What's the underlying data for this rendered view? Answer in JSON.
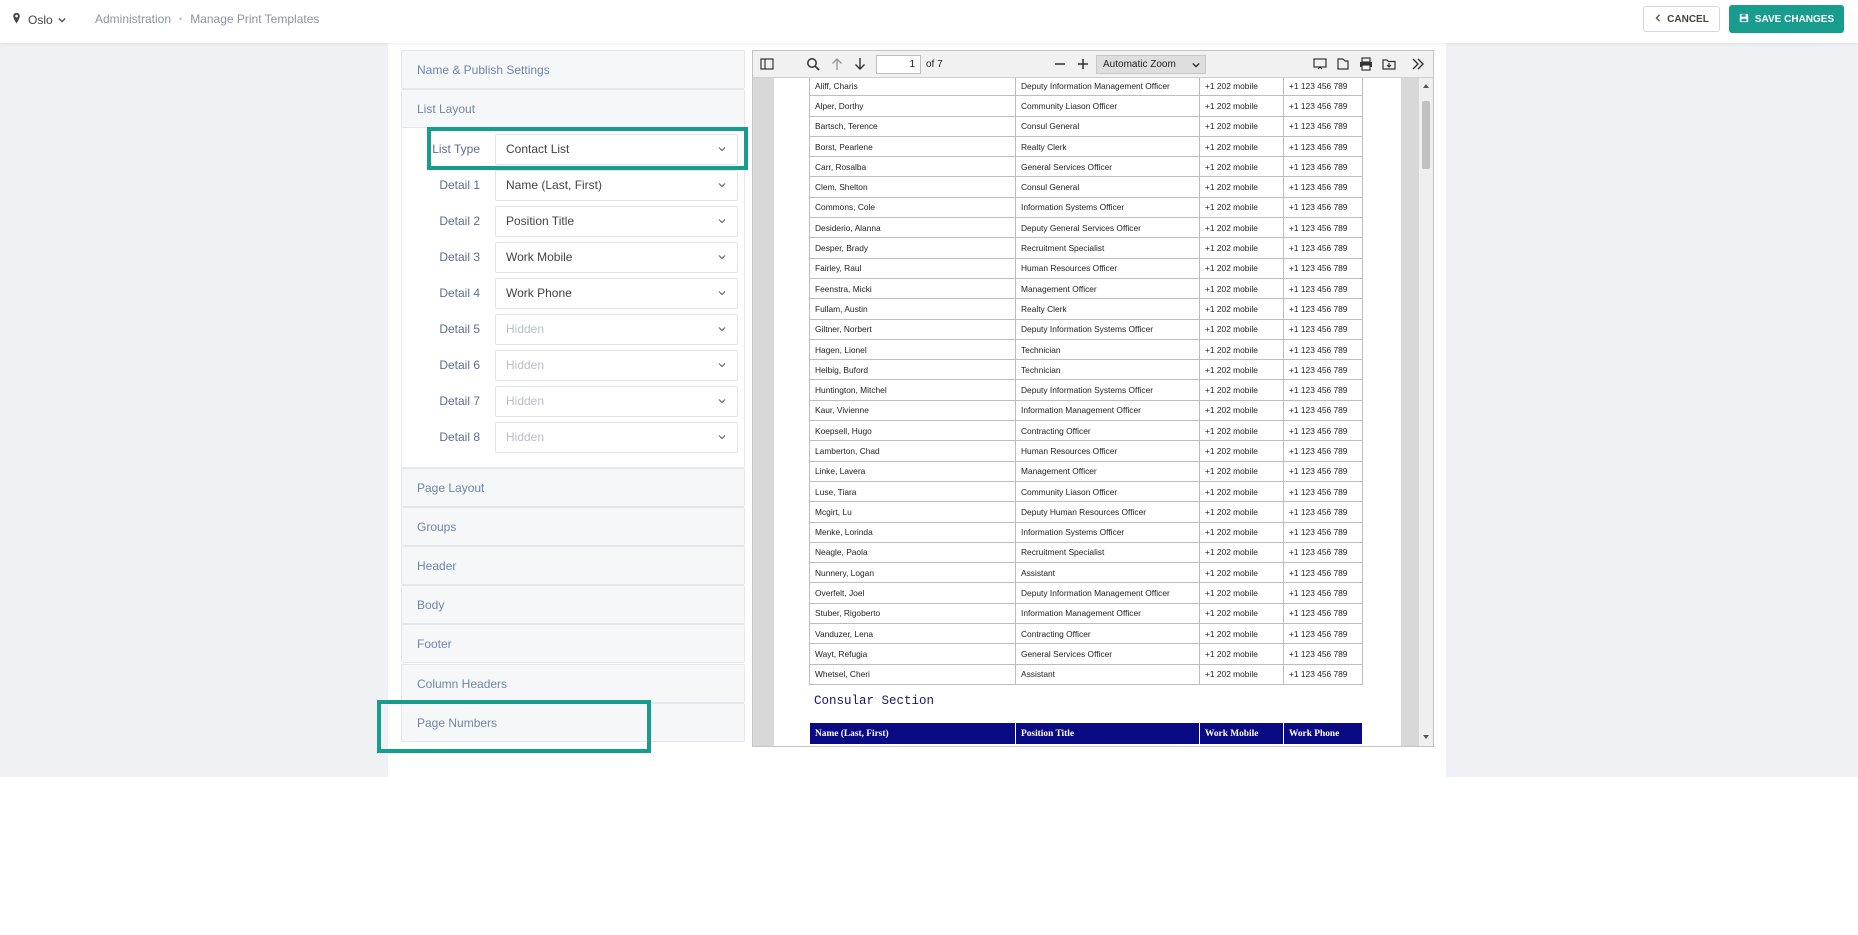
{
  "topbar": {
    "brand": "Oslo",
    "breadcrumbs": [
      "Administration",
      "Manage Print Templates"
    ],
    "cancel_label": "CANCEL",
    "save_label": "SAVE CHANGES",
    "accent_color": "#179c8e"
  },
  "sidebar": {
    "sections": [
      "Name & Publish Settings",
      "List Layout",
      "Page Layout",
      "Groups",
      "Header",
      "Body",
      "Footer",
      "Column Headers",
      "Page Numbers"
    ],
    "open_section": "List Layout",
    "fields": [
      {
        "label": "List Type",
        "value": "Contact List"
      },
      {
        "label": "Detail 1",
        "value": "Name (Last, First)"
      },
      {
        "label": "Detail 2",
        "value": "Position Title"
      },
      {
        "label": "Detail 3",
        "value": "Work Mobile"
      },
      {
        "label": "Detail 4",
        "value": "Work Phone"
      },
      {
        "label": "Detail 5",
        "value": "Hidden"
      },
      {
        "label": "Detail 6",
        "value": "Hidden"
      },
      {
        "label": "Detail 7",
        "value": "Hidden"
      },
      {
        "label": "Detail 8",
        "value": "Hidden"
      }
    ]
  },
  "viewer": {
    "page_number": "1",
    "page_count": "of 7",
    "zoom": "Automatic Zoom",
    "rows": [
      [
        "Aliff, Charis",
        "Deputy Information Management Officer",
        "+1 202 mobile",
        "+1 123 456 789"
      ],
      [
        "Alper, Dorthy",
        "Community Liason Officer",
        "+1 202 mobile",
        "+1 123 456 789"
      ],
      [
        "Bartsch, Terence",
        "Consul General",
        "+1 202 mobile",
        "+1 123 456 789"
      ],
      [
        "Borst, Pearlene",
        "Realty Clerk",
        "+1 202 mobile",
        "+1 123 456 789"
      ],
      [
        "Carr, Rosalba",
        "General Services Officer",
        "+1 202 mobile",
        "+1 123 456 789"
      ],
      [
        "Clem, Shelton",
        "Consul General",
        "+1 202 mobile",
        "+1 123 456 789"
      ],
      [
        "Commons, Cole",
        "Information Systems Officer",
        "+1 202 mobile",
        "+1 123 456 789"
      ],
      [
        "Desiderio, Alanna",
        "Deputy General Services Officer",
        "+1 202 mobile",
        "+1 123 456 789"
      ],
      [
        "Desper, Brady",
        "Recruitment Specialist",
        "+1 202 mobile",
        "+1 123 456 789"
      ],
      [
        "Fairley, Raul",
        "Human Resources Officer",
        "+1 202 mobile",
        "+1 123 456 789"
      ],
      [
        "Feenstra, Micki",
        "Management Officer",
        "+1 202 mobile",
        "+1 123 456 789"
      ],
      [
        "Fullam, Austin",
        "Realty Clerk",
        "+1 202 mobile",
        "+1 123 456 789"
      ],
      [
        "Giltner, Norbert",
        "Deputy Information Systems Officer",
        "+1 202 mobile",
        "+1 123 456 789"
      ],
      [
        "Hagen, Lionel",
        "Technician",
        "+1 202 mobile",
        "+1 123 456 789"
      ],
      [
        "Helbig, Buford",
        "Technician",
        "+1 202 mobile",
        "+1 123 456 789"
      ],
      [
        "Huntington, Mitchel",
        "Deputy Information Systems Officer",
        "+1 202 mobile",
        "+1 123 456 789"
      ],
      [
        "Kaur, Vivienne",
        "Information Management Officer",
        "+1 202 mobile",
        "+1 123 456 789"
      ],
      [
        "Koepsell, Hugo",
        "Contracting Officer",
        "+1 202 mobile",
        "+1 123 456 789"
      ],
      [
        "Lamberton, Chad",
        "Human Resources Officer",
        "+1 202 mobile",
        "+1 123 456 789"
      ],
      [
        "Linke, Lavera",
        "Management Officer",
        "+1 202 mobile",
        "+1 123 456 789"
      ],
      [
        "Luse, Tiara",
        "Community Liason Officer",
        "+1 202 mobile",
        "+1 123 456 789"
      ],
      [
        "Mcgirt, Lu",
        "Deputy Human Resources Officer",
        "+1 202 mobile",
        "+1 123 456 789"
      ],
      [
        "Menke, Lorinda",
        "Information Systems Officer",
        "+1 202 mobile",
        "+1 123 456 789"
      ],
      [
        "Neagle, Paola",
        "Recruitment Specialist",
        "+1 202 mobile",
        "+1 123 456 789"
      ],
      [
        "Nunnery, Logan",
        "Assistant",
        "+1 202 mobile",
        "+1 123 456 789"
      ],
      [
        "Overfelt, Joel",
        "Deputy Information Management Officer",
        "+1 202 mobile",
        "+1 123 456 789"
      ],
      [
        "Stuber, Rigoberto",
        "Information Management Officer",
        "+1 202 mobile",
        "+1 123 456 789"
      ],
      [
        "Vanduzer, Lena",
        "Contracting Officer",
        "+1 202 mobile",
        "+1 123 456 789"
      ],
      [
        "Wayt, Refugia",
        "General Services Officer",
        "+1 202 mobile",
        "+1 123 456 789"
      ],
      [
        "Whetsel, Cheri",
        "Assistant",
        "+1 202 mobile",
        "+1 123 456 789"
      ]
    ],
    "section_title": "Consular Section",
    "header_columns": [
      "Name (Last, First)",
      "Position Title",
      "Work Mobile",
      "Work Phone"
    ],
    "header_color": "#0a0a84"
  }
}
